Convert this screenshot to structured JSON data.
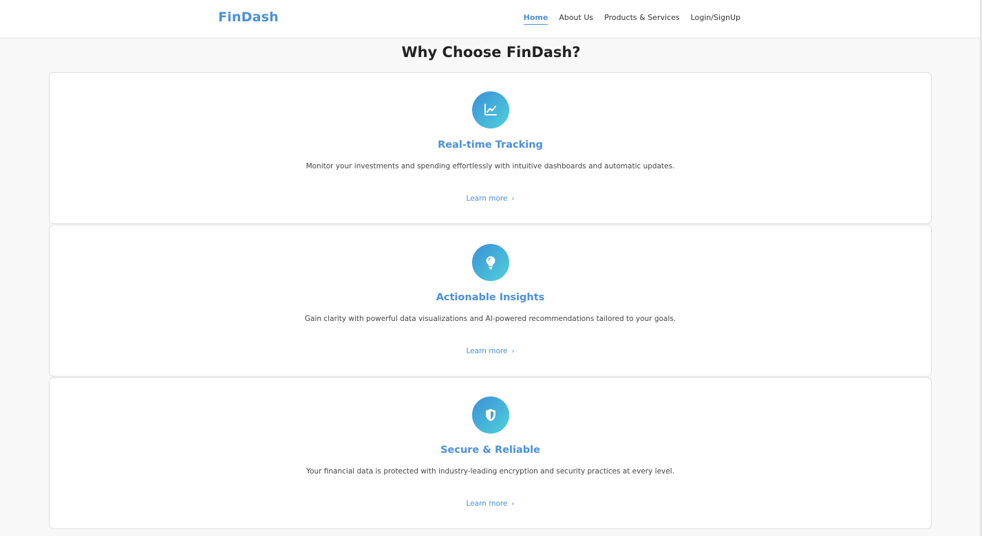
{
  "brand": "FinDash",
  "nav": {
    "home": "Home",
    "about": "About Us",
    "products": "Products & Services",
    "login": "Login/SignUp"
  },
  "section_title": "Why Choose FinDash?",
  "cards": [
    {
      "icon": "chart-line-icon",
      "title": "Real-time Tracking",
      "description": "Monitor your investments and spending effortlessly with intuitive dashboards and automatic updates.",
      "link": "Learn more"
    },
    {
      "icon": "lightbulb-icon",
      "title": "Actionable Insights",
      "description": "Gain clarity with powerful data visualizations and AI-powered recommendations tailored to your goals.",
      "link": "Learn more"
    },
    {
      "icon": "shield-icon",
      "title": "Secure & Reliable",
      "description": "Your financial data is protected with industry-leading encryption and security practices at every level.",
      "link": "Learn more"
    }
  ],
  "colors": {
    "accent": "#4a8fdc",
    "icon_gradient_start": "#3b8fd9",
    "icon_gradient_end": "#4fd1d9"
  }
}
